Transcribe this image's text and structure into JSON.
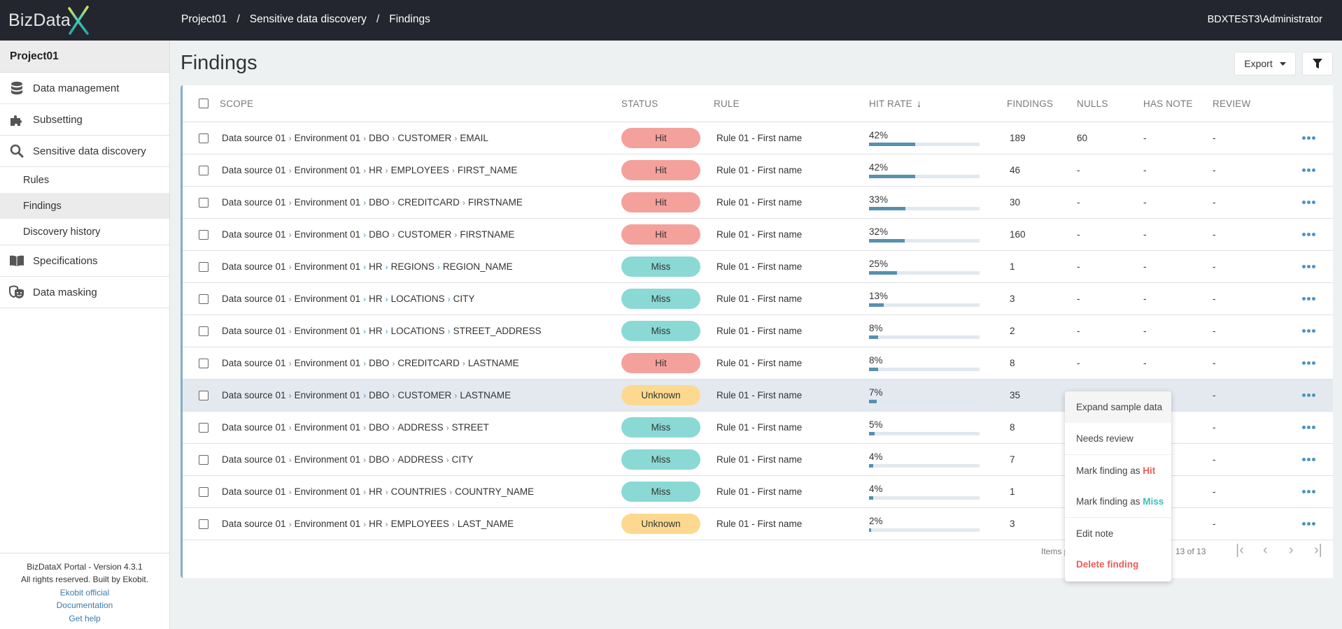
{
  "header": {
    "logo_text": "BizData",
    "breadcrumb": [
      "Project01",
      "Sensitive data discovery",
      "Findings"
    ],
    "breadcrumb_separator": "/",
    "user": "BDXTEST3\\Administrator"
  },
  "sidebar": {
    "project": "Project01",
    "items": [
      {
        "label": "Data management",
        "icon": "database-icon"
      },
      {
        "label": "Subsetting",
        "icon": "puzzle-icon"
      },
      {
        "label": "Sensitive data discovery",
        "icon": "search-icon"
      },
      {
        "label": "Specifications",
        "icon": "book-icon"
      },
      {
        "label": "Data masking",
        "icon": "masks-icon"
      }
    ],
    "sub_items": [
      {
        "label": "Rules",
        "active": false
      },
      {
        "label": "Findings",
        "active": true
      },
      {
        "label": "Discovery history",
        "active": false
      }
    ],
    "footer": {
      "version": "BizDataX Portal - Version 4.3.1",
      "rights": "All rights reserved. Built by Ekobit.",
      "links": [
        "Ekobit official",
        "Documentation",
        "Get help"
      ]
    }
  },
  "page": {
    "title": "Findings",
    "export_label": "Export",
    "filter_icon": "filter-icon"
  },
  "table": {
    "columns": [
      "SCOPE",
      "STATUS",
      "RULE",
      "HIT RATE",
      "FINDINGS",
      "NULLS",
      "HAS NOTE",
      "REVIEW"
    ],
    "sort_column": "HIT RATE",
    "sort_direction": "descending",
    "rows": [
      {
        "scope": [
          "Data source 01",
          "Environment 01",
          "DBO",
          "CUSTOMER",
          "EMAIL"
        ],
        "status": "Hit",
        "rule": "Rule 01 - First name",
        "hit_rate": "42%",
        "hit_pct": 42,
        "findings": "189",
        "nulls": "60",
        "has_note": "-",
        "review": "-"
      },
      {
        "scope": [
          "Data source 01",
          "Environment 01",
          "HR",
          "EMPLOYEES",
          "FIRST_NAME"
        ],
        "status": "Hit",
        "rule": "Rule 01 - First name",
        "hit_rate": "42%",
        "hit_pct": 42,
        "findings": "46",
        "nulls": "-",
        "has_note": "-",
        "review": "-"
      },
      {
        "scope": [
          "Data source 01",
          "Environment 01",
          "DBO",
          "CREDITCARD",
          "FIRSTNAME"
        ],
        "status": "Hit",
        "rule": "Rule 01 - First name",
        "hit_rate": "33%",
        "hit_pct": 33,
        "findings": "30",
        "nulls": "-",
        "has_note": "-",
        "review": "-"
      },
      {
        "scope": [
          "Data source 01",
          "Environment 01",
          "DBO",
          "CUSTOMER",
          "FIRSTNAME"
        ],
        "status": "Hit",
        "rule": "Rule 01 - First name",
        "hit_rate": "32%",
        "hit_pct": 32,
        "findings": "160",
        "nulls": "-",
        "has_note": "-",
        "review": "-"
      },
      {
        "scope": [
          "Data source 01",
          "Environment 01",
          "HR",
          "REGIONS",
          "REGION_NAME"
        ],
        "status": "Miss",
        "rule": "Rule 01 - First name",
        "hit_rate": "25%",
        "hit_pct": 25,
        "findings": "1",
        "nulls": "-",
        "has_note": "-",
        "review": "-"
      },
      {
        "scope": [
          "Data source 01",
          "Environment 01",
          "HR",
          "LOCATIONS",
          "CITY"
        ],
        "status": "Miss",
        "rule": "Rule 01 - First name",
        "hit_rate": "13%",
        "hit_pct": 13,
        "findings": "3",
        "nulls": "-",
        "has_note": "-",
        "review": "-"
      },
      {
        "scope": [
          "Data source 01",
          "Environment 01",
          "HR",
          "LOCATIONS",
          "STREET_ADDRESS"
        ],
        "status": "Miss",
        "rule": "Rule 01 - First name",
        "hit_rate": "8%",
        "hit_pct": 8,
        "findings": "2",
        "nulls": "-",
        "has_note": "-",
        "review": "-"
      },
      {
        "scope": [
          "Data source 01",
          "Environment 01",
          "DBO",
          "CREDITCARD",
          "LASTNAME"
        ],
        "status": "Hit",
        "rule": "Rule 01 - First name",
        "hit_rate": "8%",
        "hit_pct": 8,
        "findings": "8",
        "nulls": "-",
        "has_note": "-",
        "review": "-"
      },
      {
        "scope": [
          "Data source 01",
          "Environment 01",
          "DBO",
          "CUSTOMER",
          "LASTNAME"
        ],
        "status": "Unknown",
        "rule": "Rule 01 - First name",
        "hit_rate": "7%",
        "hit_pct": 7,
        "findings": "35",
        "nulls": "",
        "has_note": "",
        "review": "-",
        "selected": true
      },
      {
        "scope": [
          "Data source 01",
          "Environment 01",
          "DBO",
          "ADDRESS",
          "STREET"
        ],
        "status": "Miss",
        "rule": "Rule 01 - First name",
        "hit_rate": "5%",
        "hit_pct": 5,
        "findings": "8",
        "nulls": "",
        "has_note": "",
        "review": "-"
      },
      {
        "scope": [
          "Data source 01",
          "Environment 01",
          "DBO",
          "ADDRESS",
          "CITY"
        ],
        "status": "Miss",
        "rule": "Rule 01 - First name",
        "hit_rate": "4%",
        "hit_pct": 4,
        "findings": "7",
        "nulls": "",
        "has_note": "",
        "review": "-"
      },
      {
        "scope": [
          "Data source 01",
          "Environment 01",
          "HR",
          "COUNTRIES",
          "COUNTRY_NAME"
        ],
        "status": "Miss",
        "rule": "Rule 01 - First name",
        "hit_rate": "4%",
        "hit_pct": 4,
        "findings": "1",
        "nulls": "",
        "has_note": "",
        "review": "-"
      },
      {
        "scope": [
          "Data source 01",
          "Environment 01",
          "HR",
          "EMPLOYEES",
          "LAST_NAME"
        ],
        "status": "Unknown",
        "rule": "Rule 01 - First name",
        "hit_rate": "2%",
        "hit_pct": 2,
        "findings": "3",
        "nulls": "",
        "has_note": "",
        "review": "-"
      }
    ]
  },
  "pager": {
    "items_label": "Items p",
    "range": "13 of 13"
  },
  "context_menu": {
    "expand": "Expand sample data",
    "needs_review": "Needs review",
    "mark_prefix": "Mark finding as ",
    "hit": "Hit",
    "miss": "Miss",
    "edit_note": "Edit note",
    "delete": "Delete finding"
  },
  "colors": {
    "hit": "#f4a19c",
    "miss": "#8ad9d5",
    "unknown": "#fcd98f",
    "accent": "#5790b0",
    "danger": "#ef5c56"
  }
}
